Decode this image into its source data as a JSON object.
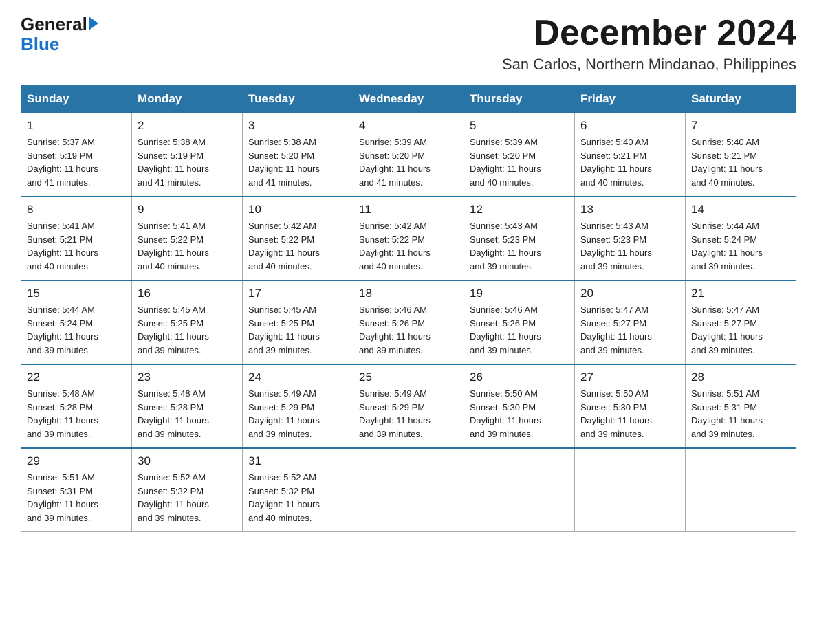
{
  "logo": {
    "general": "General",
    "arrow": "",
    "blue": "Blue"
  },
  "title": {
    "month_year": "December 2024",
    "location": "San Carlos, Northern Mindanao, Philippines"
  },
  "headers": [
    "Sunday",
    "Monday",
    "Tuesday",
    "Wednesday",
    "Thursday",
    "Friday",
    "Saturday"
  ],
  "weeks": [
    [
      {
        "day": "1",
        "sunrise": "5:37 AM",
        "sunset": "5:19 PM",
        "daylight": "11 hours and 41 minutes."
      },
      {
        "day": "2",
        "sunrise": "5:38 AM",
        "sunset": "5:19 PM",
        "daylight": "11 hours and 41 minutes."
      },
      {
        "day": "3",
        "sunrise": "5:38 AM",
        "sunset": "5:20 PM",
        "daylight": "11 hours and 41 minutes."
      },
      {
        "day": "4",
        "sunrise": "5:39 AM",
        "sunset": "5:20 PM",
        "daylight": "11 hours and 41 minutes."
      },
      {
        "day": "5",
        "sunrise": "5:39 AM",
        "sunset": "5:20 PM",
        "daylight": "11 hours and 40 minutes."
      },
      {
        "day": "6",
        "sunrise": "5:40 AM",
        "sunset": "5:21 PM",
        "daylight": "11 hours and 40 minutes."
      },
      {
        "day": "7",
        "sunrise": "5:40 AM",
        "sunset": "5:21 PM",
        "daylight": "11 hours and 40 minutes."
      }
    ],
    [
      {
        "day": "8",
        "sunrise": "5:41 AM",
        "sunset": "5:21 PM",
        "daylight": "11 hours and 40 minutes."
      },
      {
        "day": "9",
        "sunrise": "5:41 AM",
        "sunset": "5:22 PM",
        "daylight": "11 hours and 40 minutes."
      },
      {
        "day": "10",
        "sunrise": "5:42 AM",
        "sunset": "5:22 PM",
        "daylight": "11 hours and 40 minutes."
      },
      {
        "day": "11",
        "sunrise": "5:42 AM",
        "sunset": "5:22 PM",
        "daylight": "11 hours and 40 minutes."
      },
      {
        "day": "12",
        "sunrise": "5:43 AM",
        "sunset": "5:23 PM",
        "daylight": "11 hours and 39 minutes."
      },
      {
        "day": "13",
        "sunrise": "5:43 AM",
        "sunset": "5:23 PM",
        "daylight": "11 hours and 39 minutes."
      },
      {
        "day": "14",
        "sunrise": "5:44 AM",
        "sunset": "5:24 PM",
        "daylight": "11 hours and 39 minutes."
      }
    ],
    [
      {
        "day": "15",
        "sunrise": "5:44 AM",
        "sunset": "5:24 PM",
        "daylight": "11 hours and 39 minutes."
      },
      {
        "day": "16",
        "sunrise": "5:45 AM",
        "sunset": "5:25 PM",
        "daylight": "11 hours and 39 minutes."
      },
      {
        "day": "17",
        "sunrise": "5:45 AM",
        "sunset": "5:25 PM",
        "daylight": "11 hours and 39 minutes."
      },
      {
        "day": "18",
        "sunrise": "5:46 AM",
        "sunset": "5:26 PM",
        "daylight": "11 hours and 39 minutes."
      },
      {
        "day": "19",
        "sunrise": "5:46 AM",
        "sunset": "5:26 PM",
        "daylight": "11 hours and 39 minutes."
      },
      {
        "day": "20",
        "sunrise": "5:47 AM",
        "sunset": "5:27 PM",
        "daylight": "11 hours and 39 minutes."
      },
      {
        "day": "21",
        "sunrise": "5:47 AM",
        "sunset": "5:27 PM",
        "daylight": "11 hours and 39 minutes."
      }
    ],
    [
      {
        "day": "22",
        "sunrise": "5:48 AM",
        "sunset": "5:28 PM",
        "daylight": "11 hours and 39 minutes."
      },
      {
        "day": "23",
        "sunrise": "5:48 AM",
        "sunset": "5:28 PM",
        "daylight": "11 hours and 39 minutes."
      },
      {
        "day": "24",
        "sunrise": "5:49 AM",
        "sunset": "5:29 PM",
        "daylight": "11 hours and 39 minutes."
      },
      {
        "day": "25",
        "sunrise": "5:49 AM",
        "sunset": "5:29 PM",
        "daylight": "11 hours and 39 minutes."
      },
      {
        "day": "26",
        "sunrise": "5:50 AM",
        "sunset": "5:30 PM",
        "daylight": "11 hours and 39 minutes."
      },
      {
        "day": "27",
        "sunrise": "5:50 AM",
        "sunset": "5:30 PM",
        "daylight": "11 hours and 39 minutes."
      },
      {
        "day": "28",
        "sunrise": "5:51 AM",
        "sunset": "5:31 PM",
        "daylight": "11 hours and 39 minutes."
      }
    ],
    [
      {
        "day": "29",
        "sunrise": "5:51 AM",
        "sunset": "5:31 PM",
        "daylight": "11 hours and 39 minutes."
      },
      {
        "day": "30",
        "sunrise": "5:52 AM",
        "sunset": "5:32 PM",
        "daylight": "11 hours and 39 minutes."
      },
      {
        "day": "31",
        "sunrise": "5:52 AM",
        "sunset": "5:32 PM",
        "daylight": "11 hours and 40 minutes."
      },
      null,
      null,
      null,
      null
    ]
  ],
  "labels": {
    "sunrise": "Sunrise:",
    "sunset": "Sunset:",
    "daylight": "Daylight:"
  }
}
